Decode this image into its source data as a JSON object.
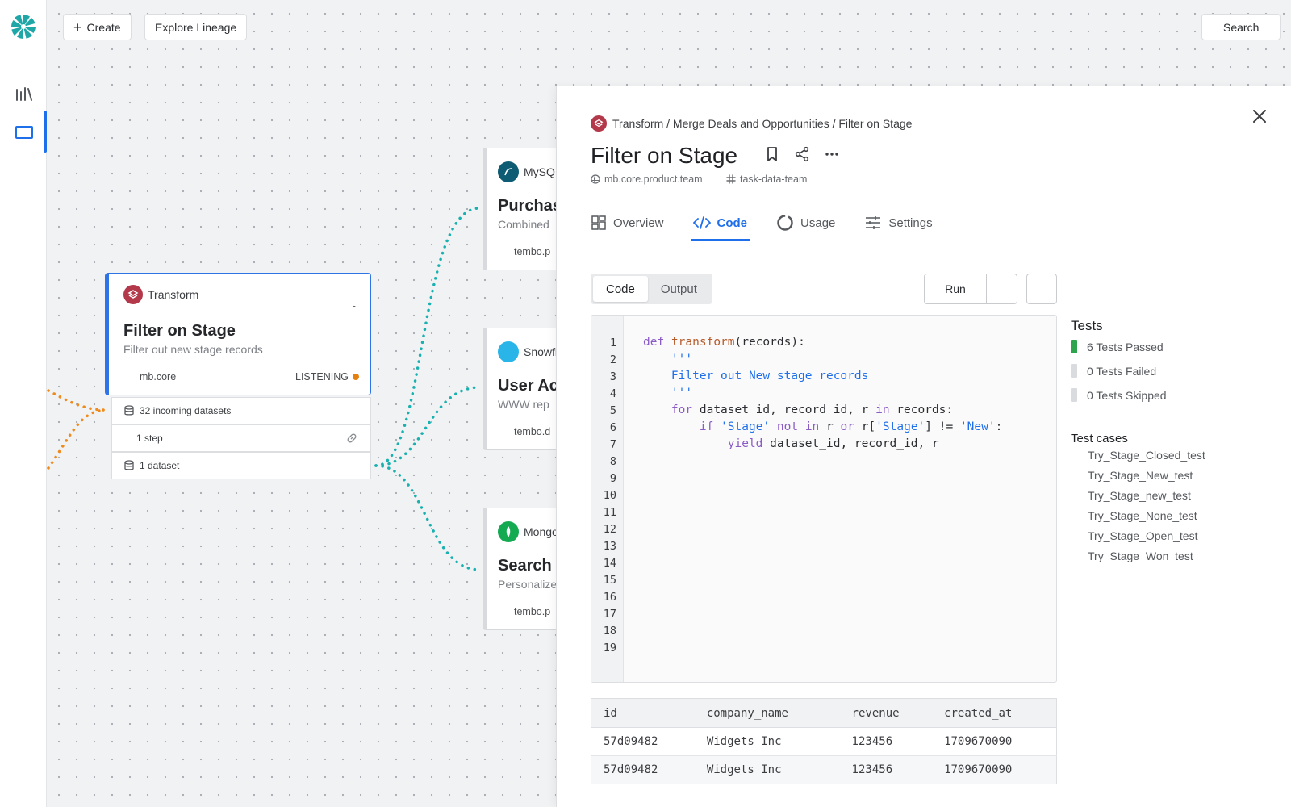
{
  "toolbar": {
    "create_label": "Create",
    "lineage_label": "Explore Lineage",
    "search_label": "Search"
  },
  "colors": {
    "accent": "#1f6feb",
    "transform": "#b2384a",
    "listening": "#e5800e",
    "lineage_out": "#19b0b0",
    "lineage_in": "#f08a1c",
    "passed": "#2ea44f"
  },
  "node": {
    "type": "Transform",
    "title": "Filter on Stage",
    "subtitle": "Filter out new stage records",
    "owner": "mb.core",
    "status": "LISTENING",
    "incoming": "32 incoming datasets",
    "steps": "1 step",
    "datasets": "1 dataset"
  },
  "side_nodes": [
    {
      "source": "MySQL",
      "title": "Purchases",
      "subtitle": "Combined",
      "owner": "tembo.p",
      "icon": "mysql-icon"
    },
    {
      "source": "Snowflake",
      "title": "User Ac",
      "subtitle": "WWW rep",
      "owner": "tembo.d",
      "icon": "snowflake-icon"
    },
    {
      "source": "Mongo",
      "title": "Search",
      "subtitle": "Personalize",
      "owner": "tembo.p",
      "icon": "mongo-icon"
    }
  ],
  "panel": {
    "breadcrumb": "Transform / Merge Deals and Opportunities / Filter on Stage",
    "title": "Filter on Stage",
    "owner": "mb.core.product.team",
    "channel": "task-data-team",
    "tabs": [
      "Overview",
      "Code",
      "Usage",
      "Settings"
    ],
    "active_tab": "Code",
    "segments": [
      "Code",
      "Output"
    ],
    "run_label": "Run",
    "line_numbers": [
      "1",
      "2",
      "3",
      "4",
      "5",
      "6",
      "7",
      "8",
      "9",
      "10",
      "11",
      "12",
      "13",
      "14",
      "15",
      "16",
      "17",
      "18",
      "19"
    ],
    "code": [
      "def transform(records):",
      "    '''",
      "    Filter out New stage records",
      "    '''",
      "    for dataset_id, record_id, r in records:",
      "        if 'Stage' not in r or r['Stage'] != 'New':",
      "            yield dataset_id, record_id, r"
    ],
    "tests": {
      "title": "Tests",
      "passed": "6 Tests Passed",
      "failed": "0 Tests Failed",
      "skipped": "0 Tests Skipped",
      "cases_title": "Test cases",
      "cases": [
        "Try_Stage_Closed_test",
        "Try_Stage_New_test",
        "Try_Stage_new_test",
        "Try_Stage_None_test",
        "Try_Stage_Open_test",
        "Try_Stage_Won_test"
      ]
    },
    "output": {
      "columns": [
        "id",
        "company_name",
        "revenue",
        "created_at"
      ],
      "rows": [
        [
          "57d09482",
          "Widgets Inc",
          "123456",
          "1709670090"
        ],
        [
          "57d09482",
          "Widgets Inc",
          "123456",
          "1709670090"
        ]
      ]
    }
  }
}
